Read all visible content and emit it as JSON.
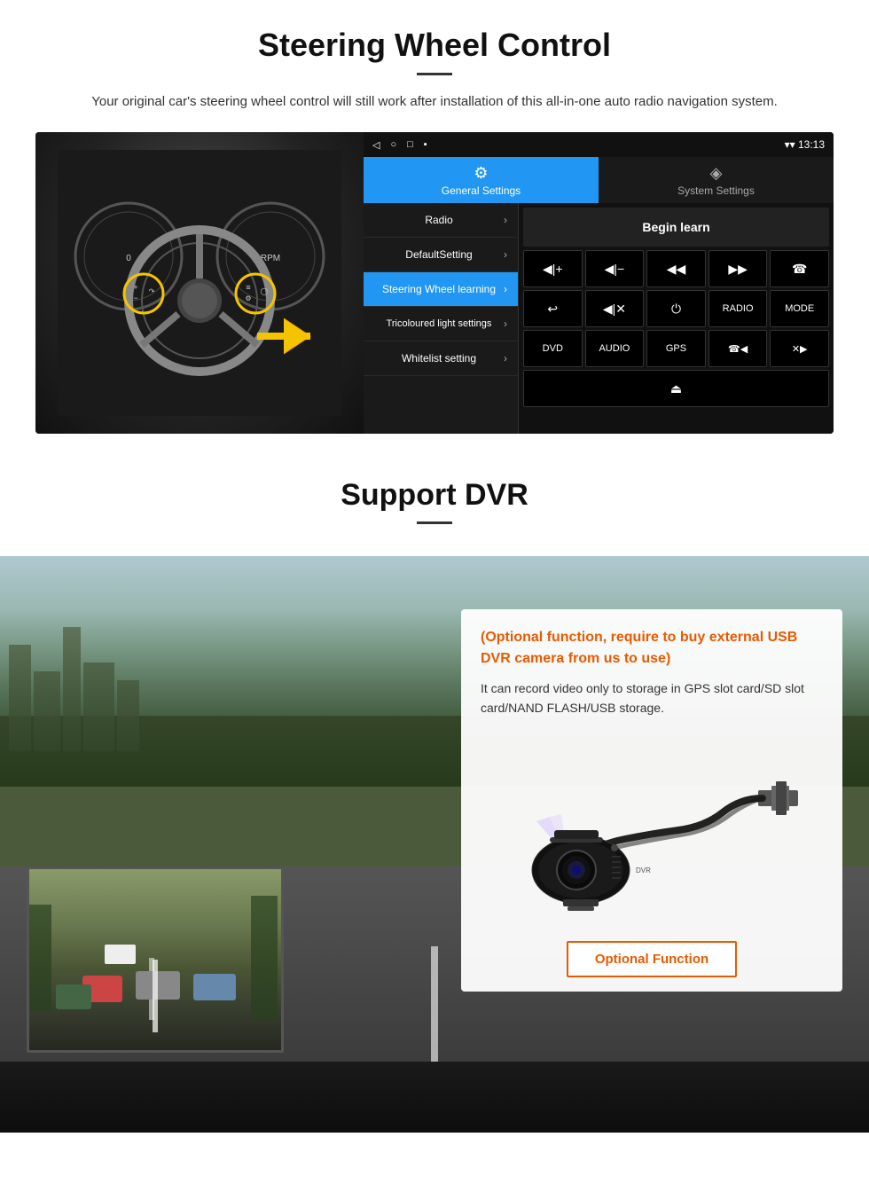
{
  "steering": {
    "title": "Steering Wheel Control",
    "description": "Your original car's steering wheel control will still work after installation of this all-in-one auto radio navigation system.",
    "statusbar": {
      "time": "13:13",
      "signal_icon": "▼",
      "wifi_icon": "▾",
      "battery_icon": "▪"
    },
    "tabs": {
      "general": "General Settings",
      "system": "System Settings"
    },
    "menu_items": [
      {
        "label": "Radio",
        "active": false
      },
      {
        "label": "DefaultSetting",
        "active": false
      },
      {
        "label": "Steering Wheel learning",
        "active": true
      },
      {
        "label": "Tricoloured light settings",
        "active": false
      },
      {
        "label": "Whitelist setting",
        "active": false
      }
    ],
    "begin_learn": "Begin learn",
    "control_buttons_row1": [
      "◀|+",
      "◀|−",
      "◀◀",
      "▶▶",
      "☎"
    ],
    "control_buttons_row2": [
      "↩",
      "◀|✕",
      "⏻",
      "RADIO",
      "MODE"
    ],
    "control_buttons_row3": [
      "DVD",
      "AUDIO",
      "GPS",
      "☎◀◀",
      "✕▶▶"
    ],
    "control_buttons_row4": [
      "⏏"
    ]
  },
  "dvr": {
    "title": "Support DVR",
    "info_title": "(Optional function, require to buy external USB DVR camera from us to use)",
    "info_text": "It can record video only to storage in GPS slot card/SD slot card/NAND FLASH/USB storage.",
    "optional_button": "Optional Function"
  }
}
